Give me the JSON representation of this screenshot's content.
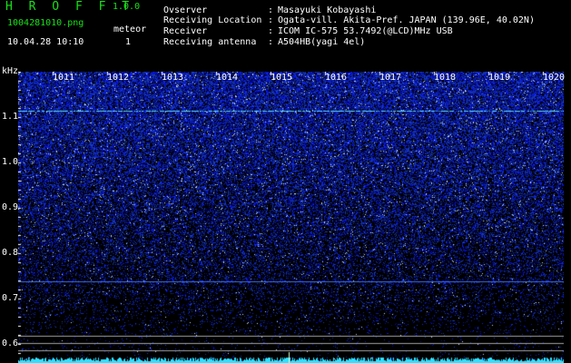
{
  "header": {
    "app_title": "H R O F F T",
    "version": "1.0.0",
    "filename": "1004281010.png",
    "datetime": "10.04.28 10:10",
    "meteor_label": "meteor",
    "meteor_count": "1"
  },
  "info": [
    {
      "label": "Ovserver",
      "value": "Masayuki Kobayashi"
    },
    {
      "label": "Receiving Location",
      "value": "Ogata-vill. Akita-Pref. JAPAN (139.96E, 40.02N)"
    },
    {
      "label": "Receiver",
      "value": "ICOM IC-575 53.7492(@LCD)MHz USB"
    },
    {
      "label": "Receiving antenna",
      "value": "A504HB(yagi 4el)"
    }
  ],
  "axis": {
    "y_unit": "kHz",
    "y_ticks": [
      "1.1",
      "1.0",
      "0.9",
      "0.8",
      "0.7",
      "0.6"
    ],
    "x_ticks": [
      "1011",
      "1012",
      "1013",
      "1014",
      "1015",
      "1016",
      "1017",
      "1018",
      "1019",
      "1020"
    ]
  },
  "colors": {
    "background": "#000000",
    "text": "#ffffff",
    "header_green": "#18e018",
    "noise": "#1a2cff",
    "signal_line": "#5ad8ff",
    "carrier_line": "#3a6cff",
    "bottom_trace": "#30e0ff",
    "ref_line": "#a0a0a0"
  }
}
